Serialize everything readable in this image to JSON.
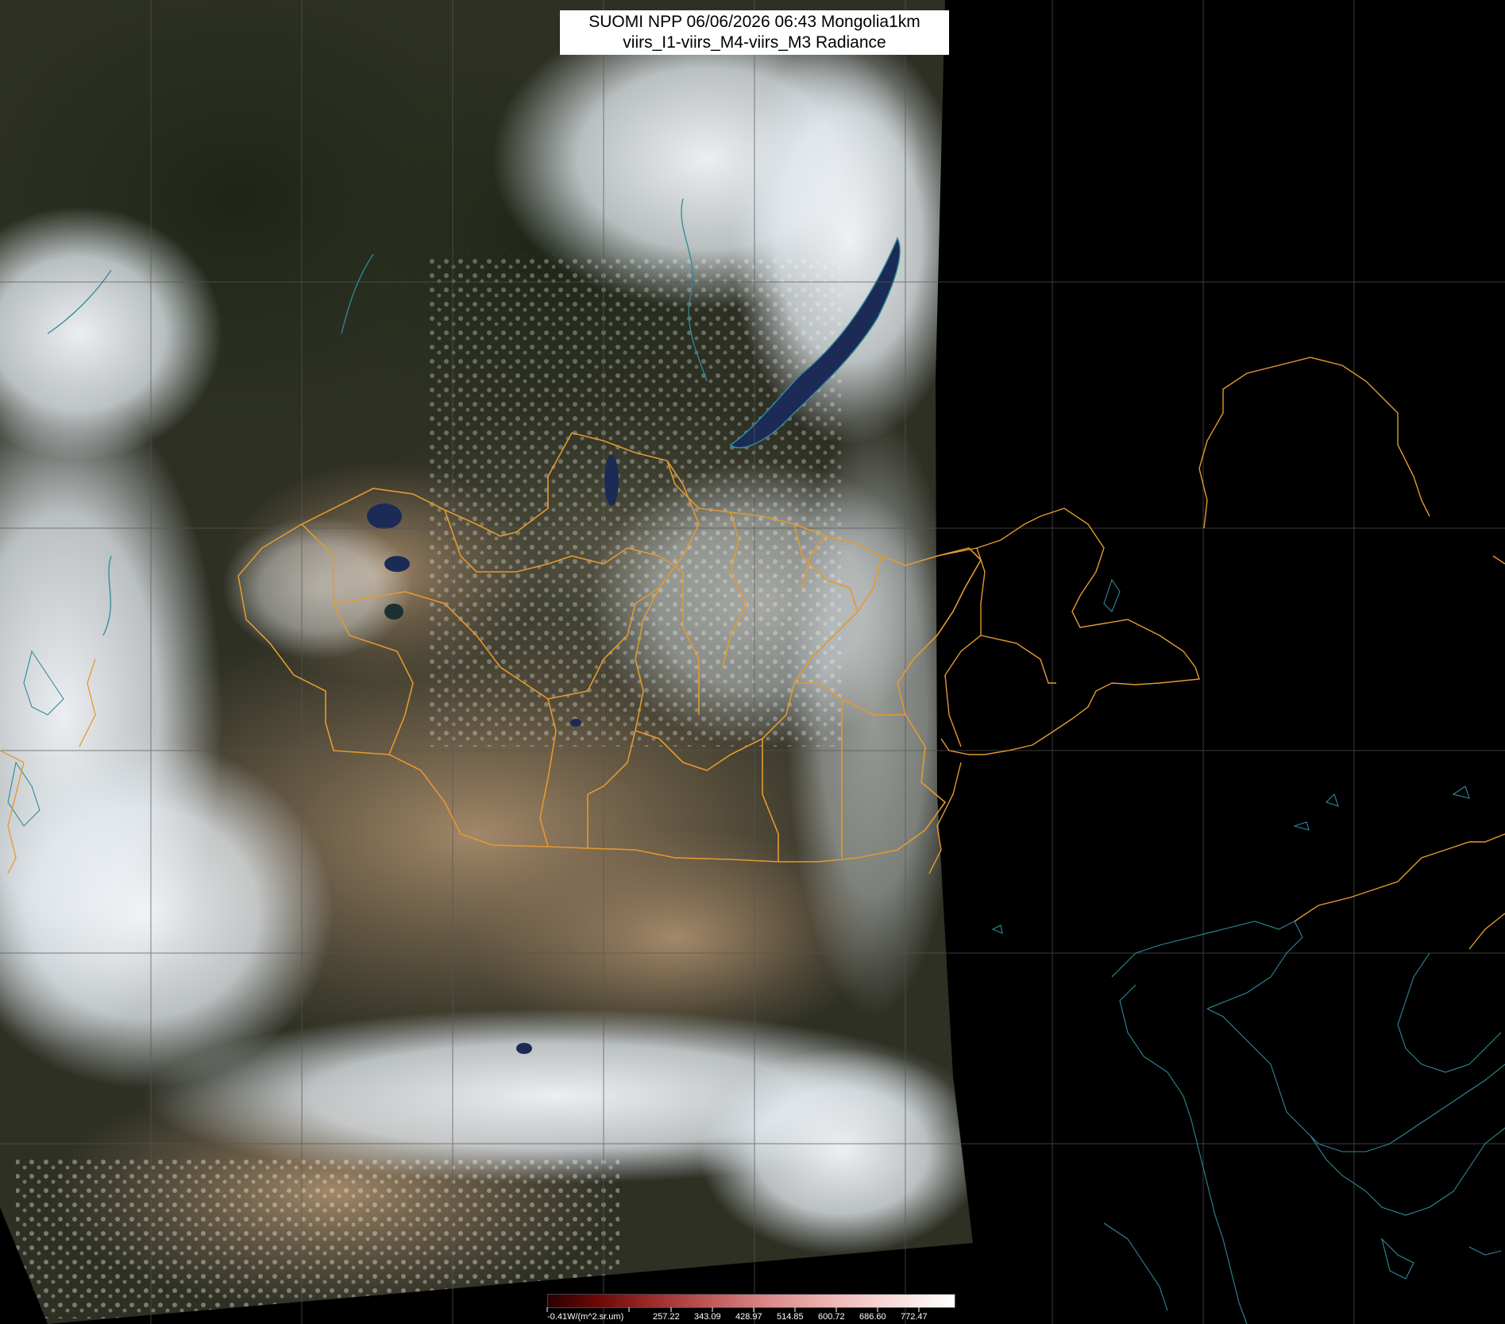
{
  "title": {
    "line1": "SUOMI NPP 06/06/2026 06:43 Mongolia1km",
    "line2": "viirs_I1-viirs_M4-viirs_M3 Radiance"
  },
  "colorbar": {
    "unit_label": "-0.41W/(m^2.sr.um)",
    "values": [
      "257.22",
      "343.09",
      "428.97",
      "514.85",
      "600.72",
      "686.60",
      "772.47"
    ]
  },
  "colors": {
    "background": "#000000",
    "border_line": "#e39a2f",
    "coastline": "#2f8a9a",
    "graticule": "#555555",
    "cloud": "#f2f6fa",
    "desert": "#9b8466",
    "forest": "#28301e",
    "lake": "#1b2b55"
  }
}
